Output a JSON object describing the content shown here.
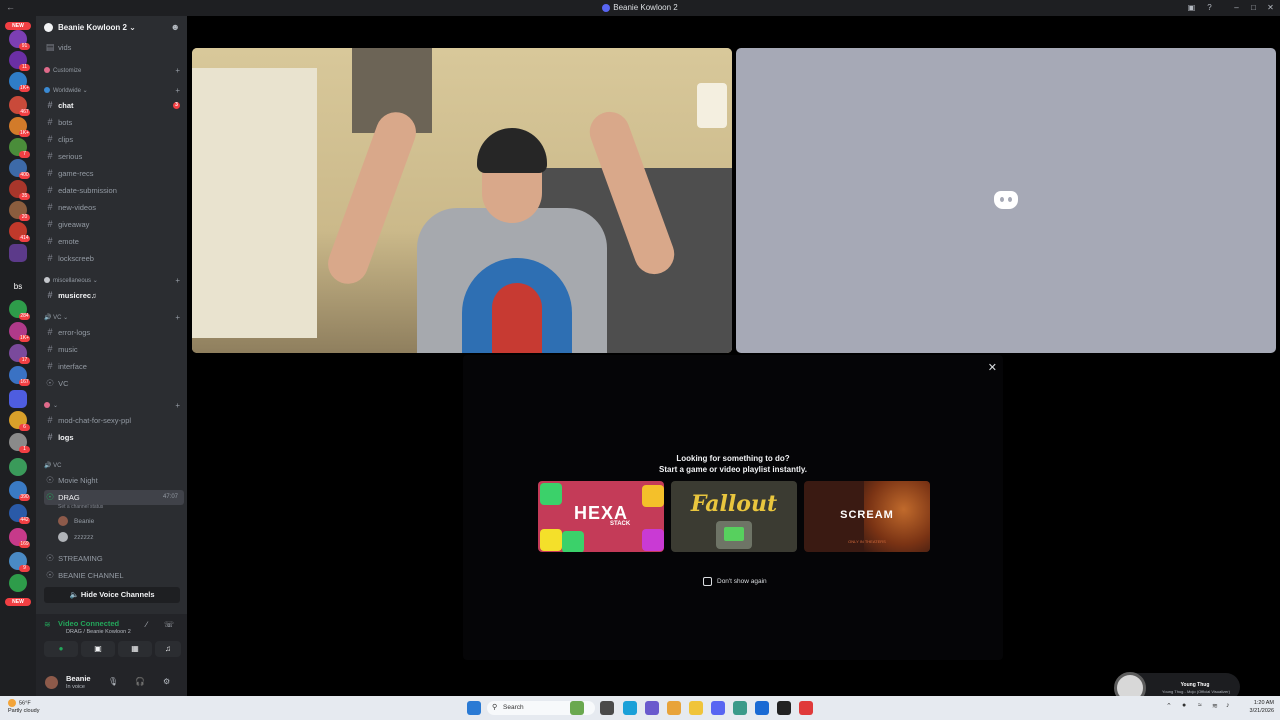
{
  "window": {
    "title": "Beanie Kowloon 2"
  },
  "server": {
    "name": "Beanie Kowloon 2"
  },
  "rail": {
    "new_label": "NEW",
    "badges": [
      "91",
      "11",
      "1K+",
      "467",
      "1K+",
      "7",
      "400",
      "35",
      "20",
      "414",
      "284",
      "1K+",
      "17",
      "167",
      "6",
      "1",
      "390",
      "442",
      "169",
      "9"
    ],
    "bs_label": "bs"
  },
  "channels": {
    "vids": "vids",
    "customize": "Customize",
    "worldwide": "Worldwide",
    "chat": "chat",
    "chat_unread": "3",
    "bots": "bots",
    "clips": "clips",
    "serious": "serious",
    "game_recs": "game-recs",
    "edate": "edate-submission",
    "new_videos": "new-videos",
    "giveaway": "giveaway",
    "emote": "emote",
    "lockscreeb": "lockscreeb",
    "misc": "miscellaneous",
    "musicrec": "musicrec♫",
    "vc_cat": "VC",
    "error_logs": "error-logs",
    "music": "music",
    "interface": "interface",
    "vc_channel": "VC",
    "mod_chat": "mod-chat-for-sexy-ppl",
    "logs": "logs",
    "vc_cat2": "VC",
    "movie_night": "Movie Night",
    "drag": "DRAG",
    "drag_count": "47:07",
    "drag_status": "Set a channel status",
    "user_beanie": "Beanie",
    "user_zz": "zzzzzz",
    "streaming": "STREAMING",
    "beanie_channel": "BEANIE CHANNEL",
    "hide_voice": "Hide Voice Channels"
  },
  "voice": {
    "status": "Video Connected",
    "sub": "DRAG / Beanie Kowloon 2"
  },
  "user": {
    "name": "Beanie",
    "status": "In voice"
  },
  "activity": {
    "line1": "Looking for something to do?",
    "line2": "Start a game or video playlist instantly.",
    "game1": "HEXA",
    "game1_sub": "STACK",
    "game2": "Fallout",
    "game3": "SCREAM",
    "game3_sub": "ONLY IN THEATERS",
    "dont_show": "Don't show again"
  },
  "toast": {
    "title": "Young Thug",
    "subtitle": "Young Thug - Mojo (Official Visualizer)"
  },
  "taskbar": {
    "temp": "56°F",
    "weather": "Partly cloudy",
    "search_placeholder": "Search",
    "time": "1:20 AM",
    "date": "3/21/2026"
  },
  "colors": {
    "accent": "#5865f2",
    "online": "#23a55a",
    "danger": "#f23f43"
  }
}
